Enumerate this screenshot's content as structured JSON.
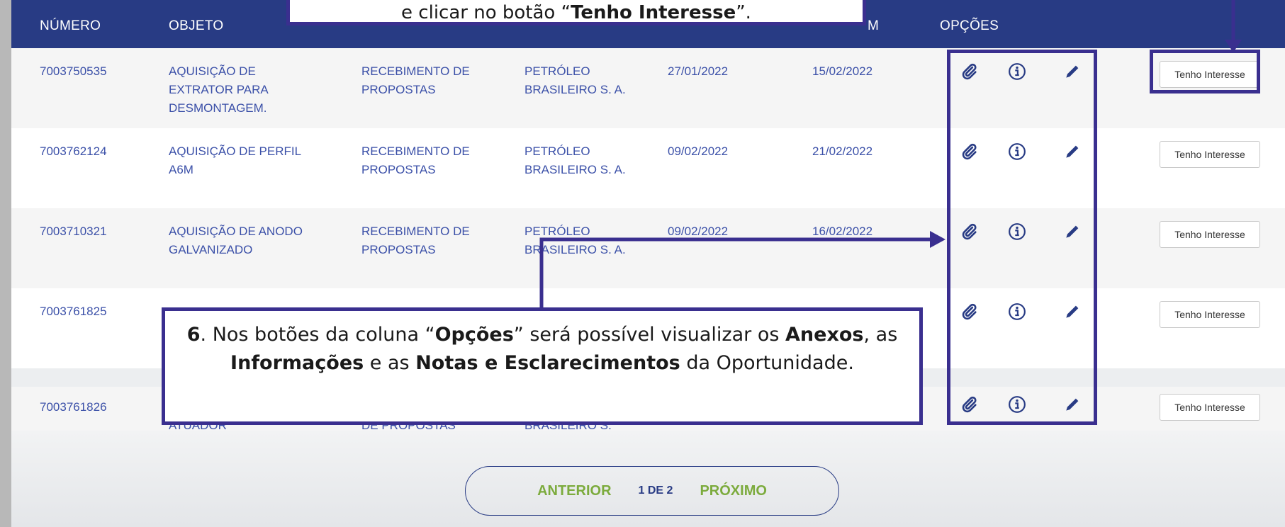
{
  "header": {
    "col_numero": "NÚMERO",
    "col_objeto": "OBJETO",
    "col_fim_partial": "M",
    "col_opcoes": "OPÇÕES"
  },
  "rows": [
    {
      "numero": "7003750535",
      "objeto": "AQUISIÇÃO DE EXTRATOR PARA DESMONTAGEM.",
      "situacao": "RECEBIMENTO DE PROPOSTAS",
      "empresa": "PETRÓLEO BRASILEIRO S. A.",
      "inicio": "27/01/2022",
      "fim": "15/02/2022",
      "button": "Tenho Interesse"
    },
    {
      "numero": "7003762124",
      "objeto": "AQUISIÇÃO DE PERFIL A6M",
      "situacao": "RECEBIMENTO DE PROPOSTAS",
      "empresa": "PETRÓLEO BRASILEIRO S. A.",
      "inicio": "09/02/2022",
      "fim": "21/02/2022",
      "button": "Tenho Interesse"
    },
    {
      "numero": "7003710321",
      "objeto": "AQUISIÇÃO DE ANODO GALVANIZADO",
      "situacao": "RECEBIMENTO DE PROPOSTAS",
      "empresa": "PETRÓLEO BRASILEIRO S. A.",
      "inicio": "09/02/2022",
      "fim": "16/02/2022",
      "button": "Tenho Interesse"
    },
    {
      "numero": "7003761825",
      "objeto": "",
      "situacao": "",
      "empresa": "",
      "inicio": "",
      "fim": "",
      "button": "Tenho Interesse"
    },
    {
      "numero": "7003761826",
      "objeto": "ATUADOR",
      "situacao": "DE PROPOSTAS",
      "empresa": "BRASILEIRO S.",
      "inicio": "",
      "fim": "",
      "button": "Tenho Interesse"
    }
  ],
  "icons": {
    "attachment": "paperclip-icon",
    "info": "info-circle-icon",
    "notes": "pencil-icon"
  },
  "pagination": {
    "prev": "ANTERIOR",
    "page": "1 DE 2",
    "next": "PRÓXIMO"
  },
  "callout_top": {
    "before": "e clicar no botão “",
    "bold": "Tenho Interesse",
    "after": "”."
  },
  "callout_main": {
    "step": "6",
    "t1": ". Nos botões da coluna “",
    "b1": "Opções",
    "t2": "” será possível visualizar os ",
    "b2": "Anexos",
    "t3": ", as ",
    "b3": "Informações",
    "t4": " e as ",
    "b4": "Notas e Esclarecimentos",
    "t5": " da Oportunidade."
  },
  "colors": {
    "header": "#283b84",
    "link": "#3b50a8",
    "annotation": "#3a2f8f",
    "pager_nav": "#7cab3d"
  }
}
